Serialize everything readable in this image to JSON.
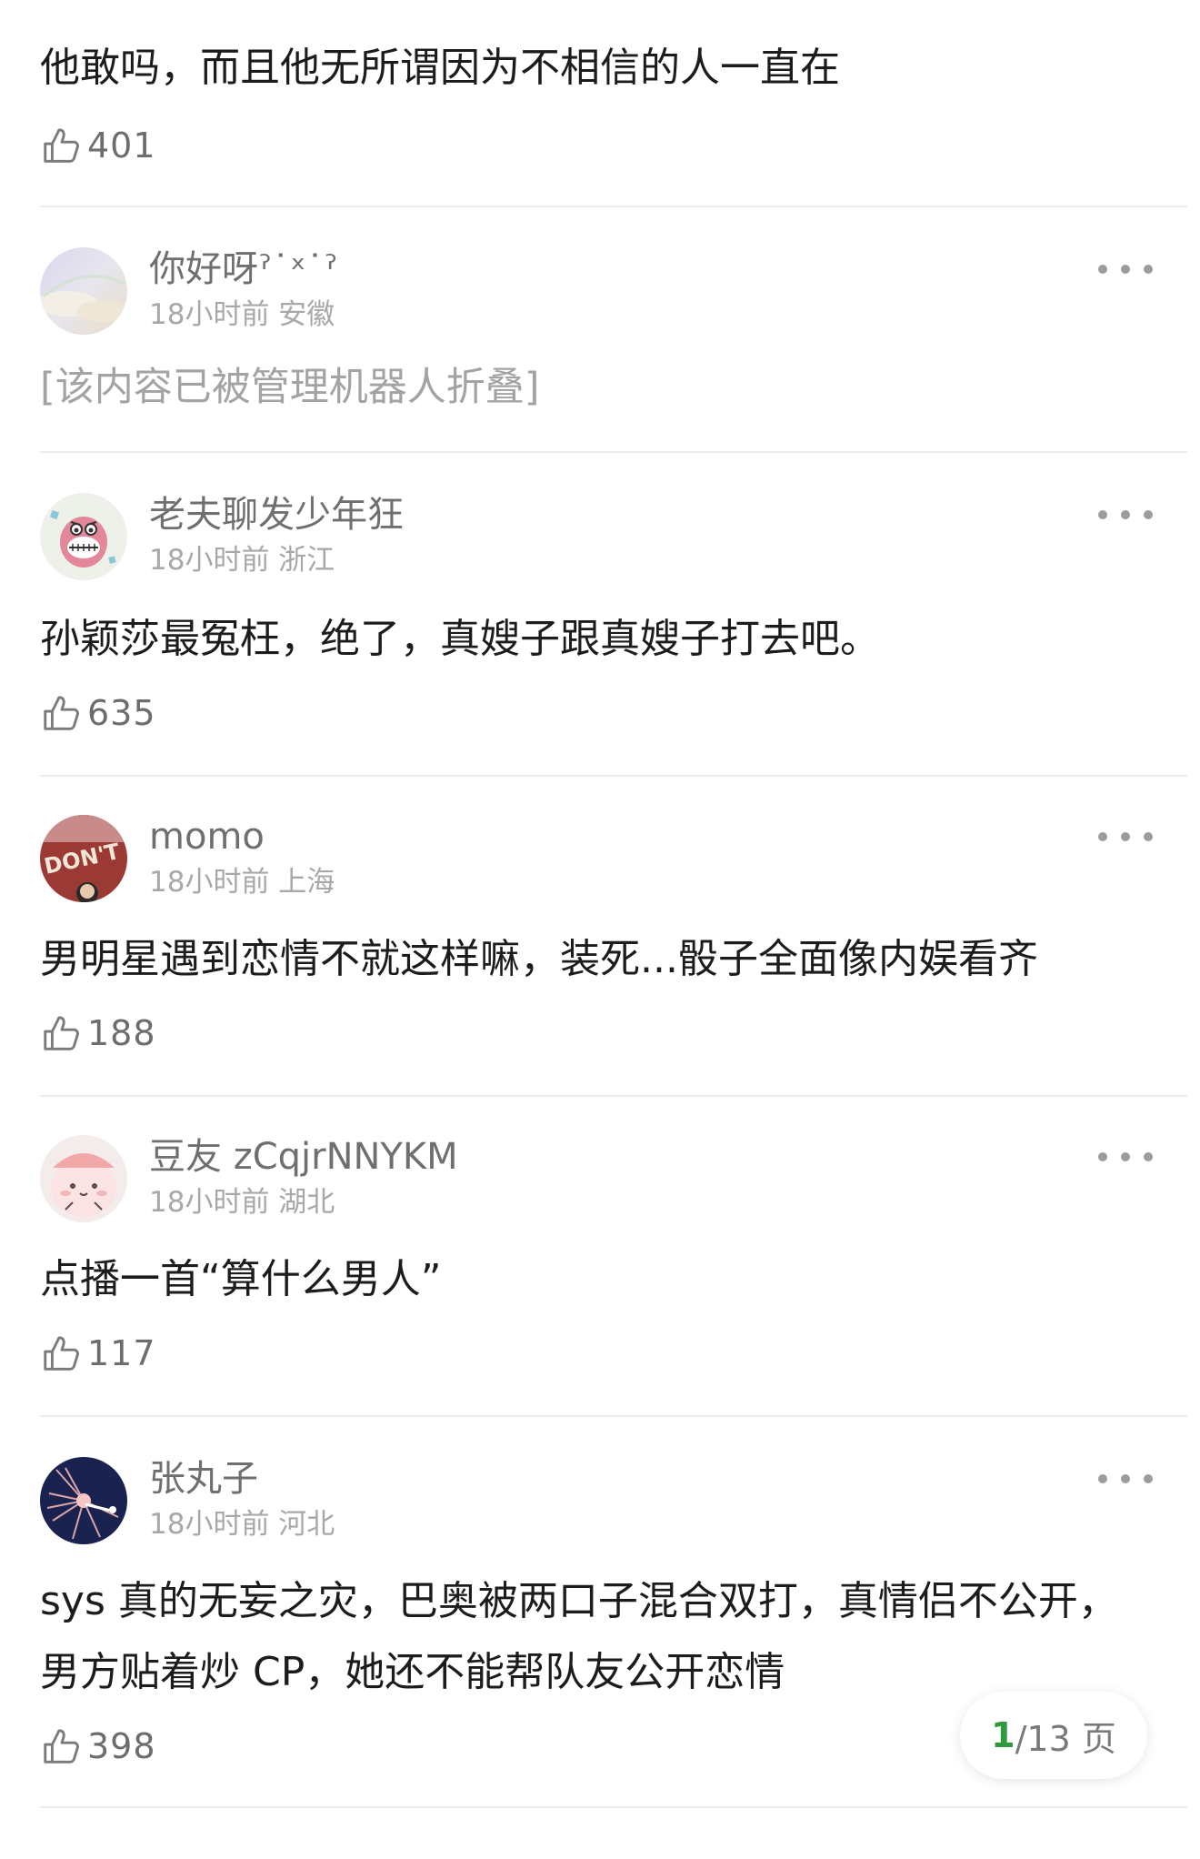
{
  "comments": [
    {
      "text": "他敢吗，而且他无所谓因为不相信的人一直在",
      "likes": "401"
    },
    {
      "username": "你好呀ˀ˙ˣ˙ˀ",
      "meta": "18小时前 安徽",
      "folded_text": "[该内容已被管理机器人折叠]"
    },
    {
      "username": "老夫聊发少年狂",
      "meta": "18小时前 浙江",
      "text": "孙颖莎最冤枉，绝了，真嫂子跟真嫂子打去吧。",
      "likes": "635"
    },
    {
      "username": "momo",
      "meta": "18小时前 上海",
      "text": "男明星遇到恋情不就这样嘛，装死...骰子全面像内娱看齐",
      "likes": "188"
    },
    {
      "username": "豆友 zCqjrNNYKM",
      "meta": "18小时前 湖北",
      "text": "点播一首“算什么男人”",
      "likes": "117"
    },
    {
      "username": "张丸子",
      "meta": "18小时前 河北",
      "text": "sys 真的无妄之灾，巴奥被两口子混合双打，真情侣不公开，男方贴着炒 CP，她还不能帮队友公开恋情",
      "likes": "398"
    }
  ],
  "avatar_texts": {
    "momo": "DON'T"
  },
  "pager": {
    "current": "1",
    "total": "/13 页"
  },
  "colors": {
    "pager_current": "#2e9a3e",
    "username": "#6f6f6f",
    "meta": "#a8a8a8",
    "body_text": "#1c1c1c",
    "divider": "#ececec"
  }
}
